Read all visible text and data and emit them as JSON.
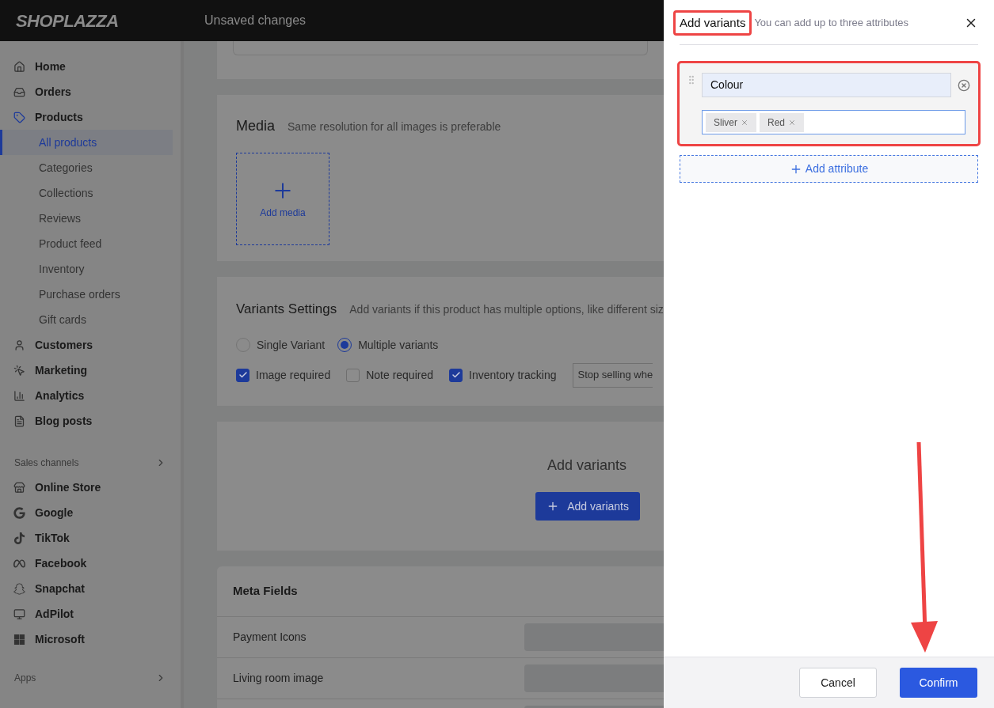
{
  "top_bar": {
    "logo": "SHOPLAZZA",
    "status": "Unsaved changes"
  },
  "sidebar": {
    "items": [
      {
        "label": "Home",
        "selected": false
      },
      {
        "label": "Orders",
        "selected": false
      },
      {
        "label": "Products",
        "selected": false,
        "children": [
          {
            "label": "All products",
            "selected": true
          },
          {
            "label": "Categories",
            "selected": false
          },
          {
            "label": "Collections",
            "selected": false
          },
          {
            "label": "Reviews",
            "selected": false
          },
          {
            "label": "Product feed",
            "selected": false
          },
          {
            "label": "Inventory",
            "selected": false
          },
          {
            "label": "Purchase orders",
            "selected": false
          },
          {
            "label": "Gift cards",
            "selected": false
          }
        ]
      },
      {
        "label": "Customers",
        "selected": false
      },
      {
        "label": "Marketing",
        "selected": false
      },
      {
        "label": "Analytics",
        "selected": false
      },
      {
        "label": "Blog posts",
        "selected": false
      }
    ],
    "sales_channels": {
      "label": "Sales channels",
      "items": [
        {
          "label": "Online Store",
          "selected": false
        },
        {
          "label": "Google",
          "selected": false
        },
        {
          "label": "TikTok",
          "selected": false
        },
        {
          "label": "Facebook",
          "selected": false
        },
        {
          "label": "Snapchat",
          "selected": false
        },
        {
          "label": "AdPilot",
          "selected": false
        },
        {
          "label": "Microsoft",
          "selected": false
        }
      ]
    },
    "apps": {
      "label": "Apps"
    }
  },
  "main": {
    "media": {
      "title": "Media",
      "hint": "Same resolution for all images is preferable",
      "add_label": "Add media"
    },
    "variants_settings": {
      "title": "Variants Settings",
      "hint": "Add variants if this product has multiple options, like different siz",
      "modes": [
        {
          "label": "Single Variant",
          "selected": false
        },
        {
          "label": "Multiple variants",
          "selected": true
        }
      ],
      "checkboxes": [
        {
          "label": "Image required",
          "checked": true
        },
        {
          "label": "Note required",
          "checked": false
        },
        {
          "label": "Inventory tracking",
          "checked": true
        }
      ],
      "stop_selling": {
        "value": "Stop selling whe"
      }
    },
    "add_variants": {
      "title": "Add variants",
      "button": "Add variants"
    },
    "meta_fields": {
      "title": "Meta Fields",
      "rows": [
        {
          "label": "Payment Icons"
        },
        {
          "label": "Living room image"
        }
      ]
    }
  },
  "drawer": {
    "title": "Add variants",
    "hint": "You can add up to three attributes",
    "attributes": [
      {
        "name": "Colour",
        "values": [
          "Sliver",
          "Red"
        ]
      }
    ],
    "add_attribute": "Add attribute",
    "cancel": "Cancel",
    "confirm": "Confirm"
  }
}
